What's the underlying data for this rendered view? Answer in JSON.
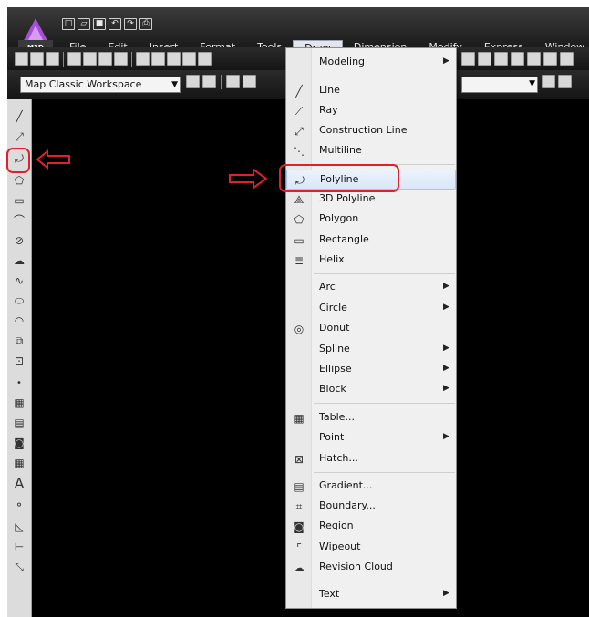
{
  "app": {
    "badge": "M3D"
  },
  "menubar": [
    {
      "label": "File"
    },
    {
      "label": "Edit"
    },
    {
      "label": "Insert"
    },
    {
      "label": "Format"
    },
    {
      "label": "Tools"
    },
    {
      "label": "Draw"
    },
    {
      "label": "Dimension"
    },
    {
      "label": "Modify"
    },
    {
      "label": "Express"
    },
    {
      "label": "Window"
    }
  ],
  "workspace": {
    "value": "Map Classic Workspace"
  },
  "draw_menu": {
    "items": [
      {
        "label": "Modeling",
        "submenu": true
      },
      {
        "label": "Line"
      },
      {
        "label": "Ray"
      },
      {
        "label": "Construction Line"
      },
      {
        "label": "Multiline"
      },
      {
        "label": "Polyline",
        "highlighted": true
      },
      {
        "label": "3D Polyline"
      },
      {
        "label": "Polygon"
      },
      {
        "label": "Rectangle"
      },
      {
        "label": "Helix"
      },
      {
        "label": "Arc",
        "submenu": true
      },
      {
        "label": "Circle",
        "submenu": true
      },
      {
        "label": "Donut"
      },
      {
        "label": "Spline",
        "submenu": true
      },
      {
        "label": "Ellipse",
        "submenu": true
      },
      {
        "label": "Block",
        "submenu": true
      },
      {
        "label": "Table..."
      },
      {
        "label": "Point",
        "submenu": true
      },
      {
        "label": "Hatch..."
      },
      {
        "label": "Gradient..."
      },
      {
        "label": "Boundary..."
      },
      {
        "label": "Region"
      },
      {
        "label": "Wipeout"
      },
      {
        "label": "Revision Cloud"
      },
      {
        "label": "Text",
        "submenu": true
      }
    ]
  },
  "annotations": {
    "highlight_color": "#e0202a"
  },
  "colors": {
    "canvas": "#000000",
    "menu_bg": "#f0f0f0",
    "titlebar": "#2b2b2b"
  }
}
